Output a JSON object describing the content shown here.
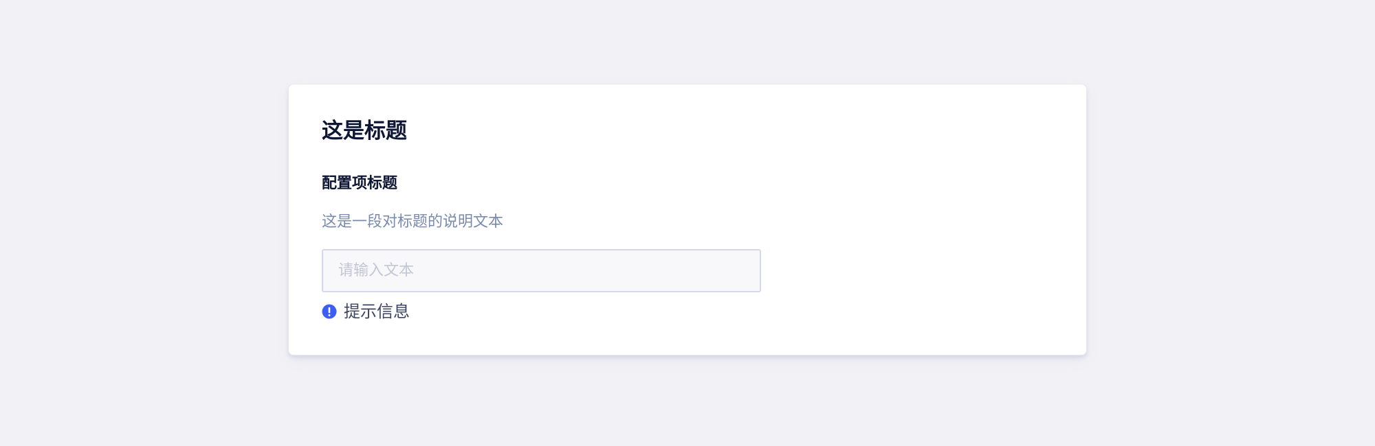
{
  "card": {
    "title": "这是标题",
    "config_item": {
      "title": "配置项标题",
      "description": "这是一段对标题的说明文本",
      "input": {
        "value": "",
        "placeholder": "请输入文本"
      },
      "hint": {
        "icon": "info-exclamation-icon",
        "text": "提示信息"
      }
    }
  },
  "colors": {
    "background": "#f2f2f6",
    "card": "#ffffff",
    "title_text": "#0e1634",
    "description_text": "#7a8aae",
    "input_border": "#d4d8ee",
    "input_background": "#f8f8fb",
    "placeholder_text": "#c2c7d6",
    "hint_icon": "#3d5ef5",
    "hint_text": "#3d4562"
  }
}
